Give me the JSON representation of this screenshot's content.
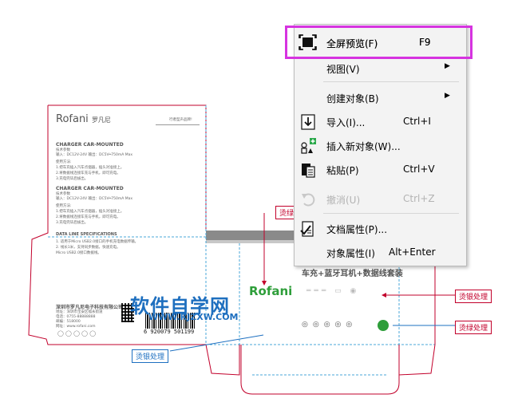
{
  "context_menu": {
    "items": [
      {
        "label": "全屏预览(F)",
        "shortcut": "F9",
        "submenu": false,
        "disabled": false,
        "icon": "fullscreen-icon"
      },
      {
        "label": "视图(V)",
        "shortcut": "",
        "submenu": true,
        "disabled": false,
        "icon": ""
      },
      {
        "label": "创建对象(B)",
        "shortcut": "",
        "submenu": true,
        "disabled": false,
        "icon": ""
      },
      {
        "label": "导入(I)...",
        "shortcut": "Ctrl+I",
        "submenu": false,
        "disabled": false,
        "icon": "import-icon"
      },
      {
        "label": "插入新对象(W)...",
        "shortcut": "",
        "submenu": false,
        "disabled": false,
        "icon": "insert-object-icon"
      },
      {
        "label": "粘贴(P)",
        "shortcut": "Ctrl+V",
        "submenu": false,
        "disabled": false,
        "icon": "paste-icon"
      },
      {
        "label": "撤消(U)",
        "shortcut": "Ctrl+Z",
        "submenu": false,
        "disabled": true,
        "icon": "undo-icon"
      },
      {
        "label": "文档属性(P)...",
        "shortcut": "",
        "submenu": false,
        "disabled": false,
        "icon": "document-properties-icon"
      },
      {
        "label": "对象属性(I)",
        "shortcut": "Alt+Enter",
        "submenu": false,
        "disabled": false,
        "icon": ""
      }
    ]
  },
  "design": {
    "brand": "Rofani",
    "brand_cn": "罗凡尼",
    "tagline": "行者型声品牌!",
    "section1_title": "CHARGER CAR-MOUNTED",
    "section1_sub": "技术参数",
    "section1_spec": "输入：DC12V-24V          输出：DC5V═750mA Max",
    "section1_notes_title": "使用方法:",
    "section1_notes": [
      "1.把车充插入汽车点烟器，插头对准接上。",
      "2.将数据线连接车充与手机，即可充电。",
      "3.充电完毕后拔出。"
    ],
    "section2_title": "CHARGER CAR-MOUNTED",
    "section2_sub": "技术参数",
    "section2_spec": "输入：DC12V-24V          输出：DC5V═750mA Max",
    "section2_notes_title": "使用方法:",
    "section2_notes": [
      "1.把车充插入汽车点烟器，插头对准接上。",
      "2.将数据线连接车充与手机，即可充电。",
      "3.充电完毕后拔出。"
    ],
    "data_line_title": "DATA LINE SPECIFICATIONS",
    "data_line_notes": [
      "1. 适用于Micro USB2.0接口的手机充电数据传输。",
      "2. 线长1米，支持同步数据，快速充电。",
      "Micro USB2.0接口数据线。"
    ],
    "company": "深圳市罗凡尼电子科技有限公司",
    "company_lines": [
      "地址：深圳市宝安区福永街道",
      "电话：0755-88888888",
      "邮编：518000",
      "网址：www.rofani.com"
    ],
    "barcode_number": "6 920079 501199",
    "product_line": "车充+蓝牙耳机+数据线套装",
    "brand_right": "Rofani",
    "watermark_cn": "软件自学网",
    "watermark_url": "WWW.RJZXW.COM"
  },
  "callouts": {
    "silver_left_bottom": "烫银处理",
    "green_top": "烫绿处理",
    "silver_right": "烫银处理",
    "green_right": "烫绿处理"
  },
  "colors": {
    "highlight_border": "#d633e0",
    "selected_bg": "#dff3fb",
    "watermark_blue": "#1e6fbf",
    "outline_red": "#c2002b",
    "fold_blue": "#4aa7d8",
    "brand_green": "#2e9e3a"
  }
}
